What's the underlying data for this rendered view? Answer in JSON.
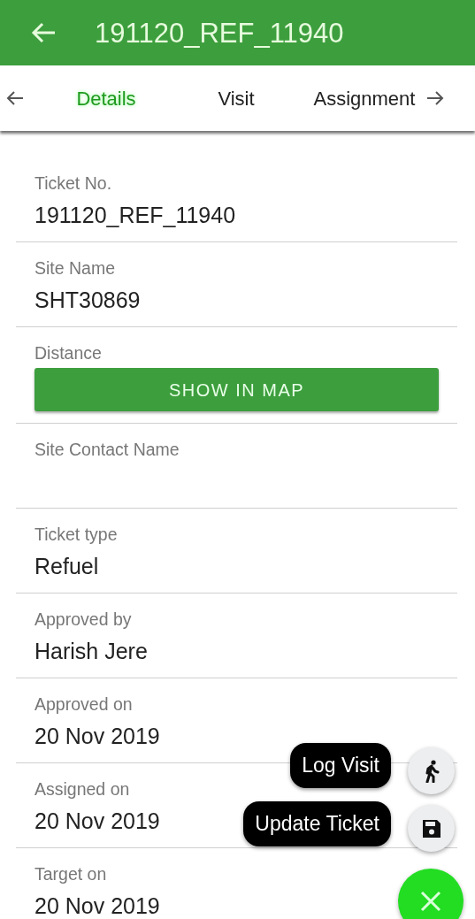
{
  "app_bar": {
    "title": "191120_REF_11940"
  },
  "tabs": [
    {
      "label": "Details",
      "selected": true
    },
    {
      "label": "Visit",
      "selected": false
    },
    {
      "label": "Assignment",
      "selected": false
    }
  ],
  "fields": [
    {
      "kind": "text",
      "label": "Ticket No.",
      "value": "191120_REF_11940"
    },
    {
      "kind": "text",
      "label": "Site Name",
      "value": "SHT30869"
    },
    {
      "kind": "button",
      "label": "Distance",
      "button": "SHOW IN MAP"
    },
    {
      "kind": "text",
      "label": "Site Contact Name"
    },
    {
      "kind": "text",
      "label": "Ticket type",
      "value": "Refuel"
    },
    {
      "kind": "text",
      "label": "Approved by",
      "value": "Harish Jere"
    },
    {
      "kind": "text",
      "label": "Approved on",
      "value": "20 Nov 2019"
    },
    {
      "kind": "text",
      "label": "Assigned on",
      "value": "20 Nov 2019"
    },
    {
      "kind": "text",
      "label": "Target on",
      "value": "20 Nov 2019"
    }
  ],
  "fab_menu": {
    "expanded": true,
    "actions": [
      {
        "kind": "visit",
        "label": "Log Visit"
      },
      {
        "kind": "save",
        "label": "Update Ticket"
      }
    ]
  }
}
